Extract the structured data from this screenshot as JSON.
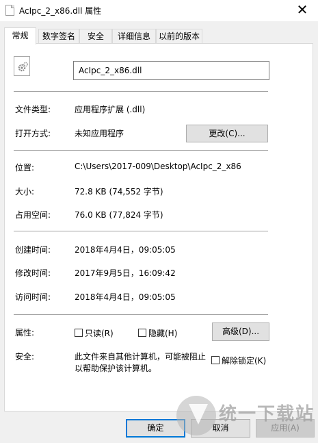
{
  "window": {
    "title": "AcIpc_2_x86.dll 属性",
    "close_label": "✕"
  },
  "tabs": [
    {
      "label": "常规",
      "active": true
    },
    {
      "label": "数字签名"
    },
    {
      "label": "安全"
    },
    {
      "label": "详细信息"
    },
    {
      "label": "以前的版本"
    }
  ],
  "general": {
    "file_name": "AcIpc_2_x86.dll",
    "file_type_label": "文件类型:",
    "file_type_value": "应用程序扩展 (.dll)",
    "opens_with_label": "打开方式:",
    "opens_with_value": "未知应用程序",
    "change_button": "更改(C)...",
    "location_label": "位置:",
    "location_value": "C:\\Users\\2017-009\\Desktop\\AcIpc_2_x86",
    "size_label": "大小:",
    "size_value": "72.8 KB (74,552 字节)",
    "size_on_disk_label": "占用空间:",
    "size_on_disk_value": "76.0 KB (77,824 字节)",
    "created_label": "创建时间:",
    "created_value": "2018年4月4日，09:05:05",
    "modified_label": "修改时间:",
    "modified_value": "2017年9月5日，16:09:42",
    "accessed_label": "访问时间:",
    "accessed_value": "2018年4月4日，09:05:05",
    "attributes_label": "属性:",
    "readonly_label": "只读(R)",
    "hidden_label": "隐藏(H)",
    "advanced_button": "高级(D)...",
    "security_label": "安全:",
    "security_text_line1": "此文件来自其他计算机，可能被阻止",
    "security_text_line2": "以帮助保护该计算机。",
    "unblock_label": "解除锁定(K)"
  },
  "footer": {
    "ok_button": "确定",
    "cancel_button": "取消",
    "apply_button": "应用(A)"
  },
  "watermark": {
    "text": "统一下载站"
  }
}
